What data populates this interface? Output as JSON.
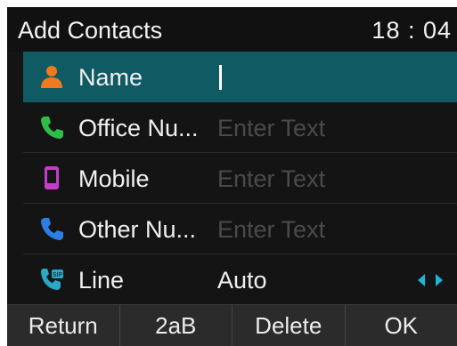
{
  "header": {
    "title": "Add Contacts",
    "time": "18 : 04"
  },
  "fields": [
    {
      "label": "Name",
      "value": "",
      "icon": "person-icon",
      "icon_color": "#f07a1e",
      "selected": true
    },
    {
      "label": "Office Nu...",
      "placeholder": "Enter Text",
      "icon": "phone-icon",
      "icon_color": "#2ebd48"
    },
    {
      "label": "Mobile",
      "placeholder": "Enter Text",
      "icon": "mobile-icon",
      "icon_color": "#c63cc9"
    },
    {
      "label": "Other Nu...",
      "placeholder": "Enter Text",
      "icon": "phone-icon",
      "icon_color": "#2e7de0"
    },
    {
      "label": "Line",
      "value": "Auto",
      "icon": "sip-phone-icon",
      "icon_color": "#29a8c7"
    }
  ],
  "softkeys": [
    "Return",
    "2aB",
    "Delete",
    "OK"
  ],
  "colors": {
    "selected_row": "#105a63",
    "arrow_accent": "#1fb4d8"
  }
}
